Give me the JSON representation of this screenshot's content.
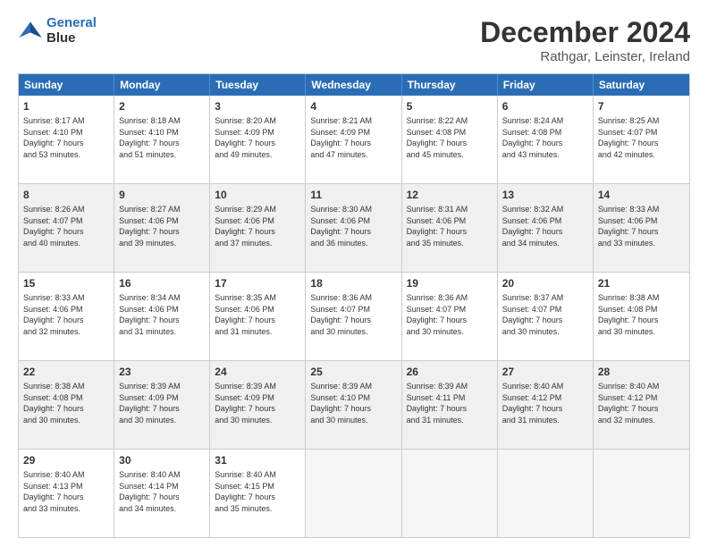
{
  "logo": {
    "line1": "General",
    "line2": "Blue"
  },
  "title": "December 2024",
  "location": "Rathgar, Leinster, Ireland",
  "header_days": [
    "Sunday",
    "Monday",
    "Tuesday",
    "Wednesday",
    "Thursday",
    "Friday",
    "Saturday"
  ],
  "weeks": [
    [
      {
        "day": "1",
        "info": "Sunrise: 8:17 AM\nSunset: 4:10 PM\nDaylight: 7 hours\nand 53 minutes."
      },
      {
        "day": "2",
        "info": "Sunrise: 8:18 AM\nSunset: 4:10 PM\nDaylight: 7 hours\nand 51 minutes."
      },
      {
        "day": "3",
        "info": "Sunrise: 8:20 AM\nSunset: 4:09 PM\nDaylight: 7 hours\nand 49 minutes."
      },
      {
        "day": "4",
        "info": "Sunrise: 8:21 AM\nSunset: 4:09 PM\nDaylight: 7 hours\nand 47 minutes."
      },
      {
        "day": "5",
        "info": "Sunrise: 8:22 AM\nSunset: 4:08 PM\nDaylight: 7 hours\nand 45 minutes."
      },
      {
        "day": "6",
        "info": "Sunrise: 8:24 AM\nSunset: 4:08 PM\nDaylight: 7 hours\nand 43 minutes."
      },
      {
        "day": "7",
        "info": "Sunrise: 8:25 AM\nSunset: 4:07 PM\nDaylight: 7 hours\nand 42 minutes."
      }
    ],
    [
      {
        "day": "8",
        "info": "Sunrise: 8:26 AM\nSunset: 4:07 PM\nDaylight: 7 hours\nand 40 minutes."
      },
      {
        "day": "9",
        "info": "Sunrise: 8:27 AM\nSunset: 4:06 PM\nDaylight: 7 hours\nand 39 minutes."
      },
      {
        "day": "10",
        "info": "Sunrise: 8:29 AM\nSunset: 4:06 PM\nDaylight: 7 hours\nand 37 minutes."
      },
      {
        "day": "11",
        "info": "Sunrise: 8:30 AM\nSunset: 4:06 PM\nDaylight: 7 hours\nand 36 minutes."
      },
      {
        "day": "12",
        "info": "Sunrise: 8:31 AM\nSunset: 4:06 PM\nDaylight: 7 hours\nand 35 minutes."
      },
      {
        "day": "13",
        "info": "Sunrise: 8:32 AM\nSunset: 4:06 PM\nDaylight: 7 hours\nand 34 minutes."
      },
      {
        "day": "14",
        "info": "Sunrise: 8:33 AM\nSunset: 4:06 PM\nDaylight: 7 hours\nand 33 minutes."
      }
    ],
    [
      {
        "day": "15",
        "info": "Sunrise: 8:33 AM\nSunset: 4:06 PM\nDaylight: 7 hours\nand 32 minutes."
      },
      {
        "day": "16",
        "info": "Sunrise: 8:34 AM\nSunset: 4:06 PM\nDaylight: 7 hours\nand 31 minutes."
      },
      {
        "day": "17",
        "info": "Sunrise: 8:35 AM\nSunset: 4:06 PM\nDaylight: 7 hours\nand 31 minutes."
      },
      {
        "day": "18",
        "info": "Sunrise: 8:36 AM\nSunset: 4:07 PM\nDaylight: 7 hours\nand 30 minutes."
      },
      {
        "day": "19",
        "info": "Sunrise: 8:36 AM\nSunset: 4:07 PM\nDaylight: 7 hours\nand 30 minutes."
      },
      {
        "day": "20",
        "info": "Sunrise: 8:37 AM\nSunset: 4:07 PM\nDaylight: 7 hours\nand 30 minutes."
      },
      {
        "day": "21",
        "info": "Sunrise: 8:38 AM\nSunset: 4:08 PM\nDaylight: 7 hours\nand 30 minutes."
      }
    ],
    [
      {
        "day": "22",
        "info": "Sunrise: 8:38 AM\nSunset: 4:08 PM\nDaylight: 7 hours\nand 30 minutes."
      },
      {
        "day": "23",
        "info": "Sunrise: 8:39 AM\nSunset: 4:09 PM\nDaylight: 7 hours\nand 30 minutes."
      },
      {
        "day": "24",
        "info": "Sunrise: 8:39 AM\nSunset: 4:09 PM\nDaylight: 7 hours\nand 30 minutes."
      },
      {
        "day": "25",
        "info": "Sunrise: 8:39 AM\nSunset: 4:10 PM\nDaylight: 7 hours\nand 30 minutes."
      },
      {
        "day": "26",
        "info": "Sunrise: 8:39 AM\nSunset: 4:11 PM\nDaylight: 7 hours\nand 31 minutes."
      },
      {
        "day": "27",
        "info": "Sunrise: 8:40 AM\nSunset: 4:12 PM\nDaylight: 7 hours\nand 31 minutes."
      },
      {
        "day": "28",
        "info": "Sunrise: 8:40 AM\nSunset: 4:12 PM\nDaylight: 7 hours\nand 32 minutes."
      }
    ],
    [
      {
        "day": "29",
        "info": "Sunrise: 8:40 AM\nSunset: 4:13 PM\nDaylight: 7 hours\nand 33 minutes."
      },
      {
        "day": "30",
        "info": "Sunrise: 8:40 AM\nSunset: 4:14 PM\nDaylight: 7 hours\nand 34 minutes."
      },
      {
        "day": "31",
        "info": "Sunrise: 8:40 AM\nSunset: 4:15 PM\nDaylight: 7 hours\nand 35 minutes."
      },
      {
        "day": "",
        "info": ""
      },
      {
        "day": "",
        "info": ""
      },
      {
        "day": "",
        "info": ""
      },
      {
        "day": "",
        "info": ""
      }
    ]
  ]
}
